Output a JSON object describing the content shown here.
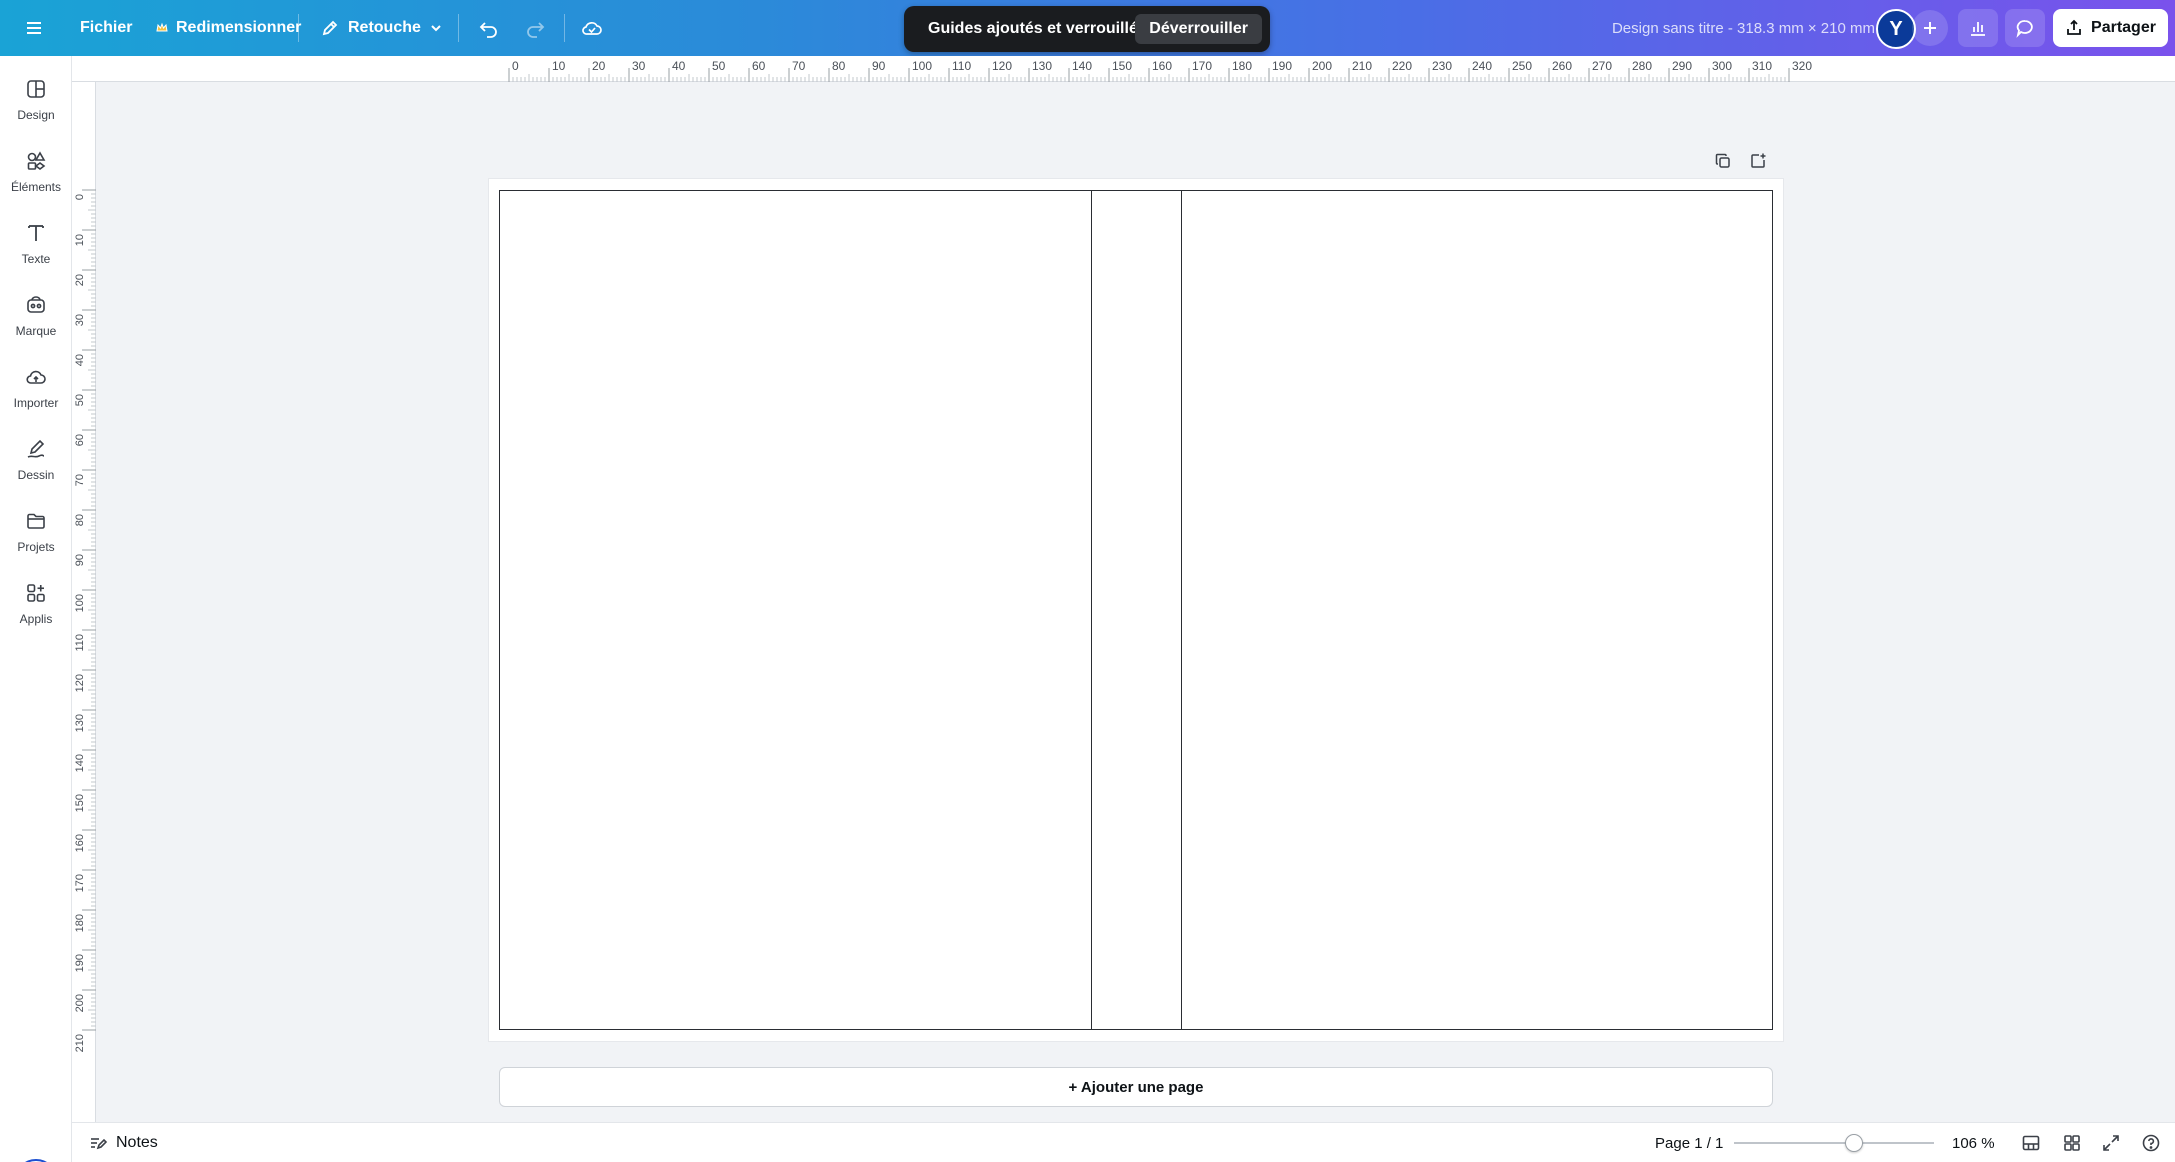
{
  "topbar": {
    "file_label": "Fichier",
    "resize_label": "Redimensionner",
    "edit_label": "Retouche",
    "doc_title": "Design sans titre - 318.3 mm × 210 mm",
    "avatar_initial": "Y",
    "share_label": "Partager"
  },
  "toast": {
    "message": "Guides ajoutés et verrouillés",
    "action_label": "Déverrouiller"
  },
  "sidebar": {
    "items": [
      {
        "label": "Design",
        "icon": "design-icon"
      },
      {
        "label": "Éléments",
        "icon": "elements-icon"
      },
      {
        "label": "Texte",
        "icon": "text-icon"
      },
      {
        "label": "Marque",
        "icon": "brand-icon"
      },
      {
        "label": "Importer",
        "icon": "upload-cloud-icon"
      },
      {
        "label": "Dessin",
        "icon": "draw-icon"
      },
      {
        "label": "Projets",
        "icon": "folder-icon"
      },
      {
        "label": "Applis",
        "icon": "apps-icon"
      }
    ]
  },
  "ruler": {
    "top_ticks": [
      "0",
      "10",
      "20",
      "30",
      "40",
      "50",
      "60",
      "70",
      "80",
      "90",
      "100",
      "110",
      "120",
      "130",
      "140",
      "150",
      "160",
      "170",
      "180",
      "190",
      "200",
      "210",
      "220",
      "230",
      "240",
      "250",
      "260",
      "270",
      "280",
      "290",
      "300",
      "310",
      "320"
    ],
    "left_ticks": [
      "0",
      "10",
      "20",
      "30",
      "40",
      "50",
      "60",
      "70",
      "80",
      "90",
      "100",
      "110",
      "120",
      "130",
      "140",
      "150",
      "160",
      "170",
      "180",
      "190",
      "200",
      "210"
    ]
  },
  "canvas": {
    "add_page_label": "+ Ajouter une page"
  },
  "bottombar": {
    "notes_label": "Notes",
    "page_count": "Page 1 / 1",
    "zoom_value": "106 %"
  },
  "colors": {
    "topbar_start": "#1aa3d6",
    "topbar_end": "#7a52ec",
    "toast_bg": "#1a1c1f",
    "avatar_bg": "#0b3a99"
  }
}
